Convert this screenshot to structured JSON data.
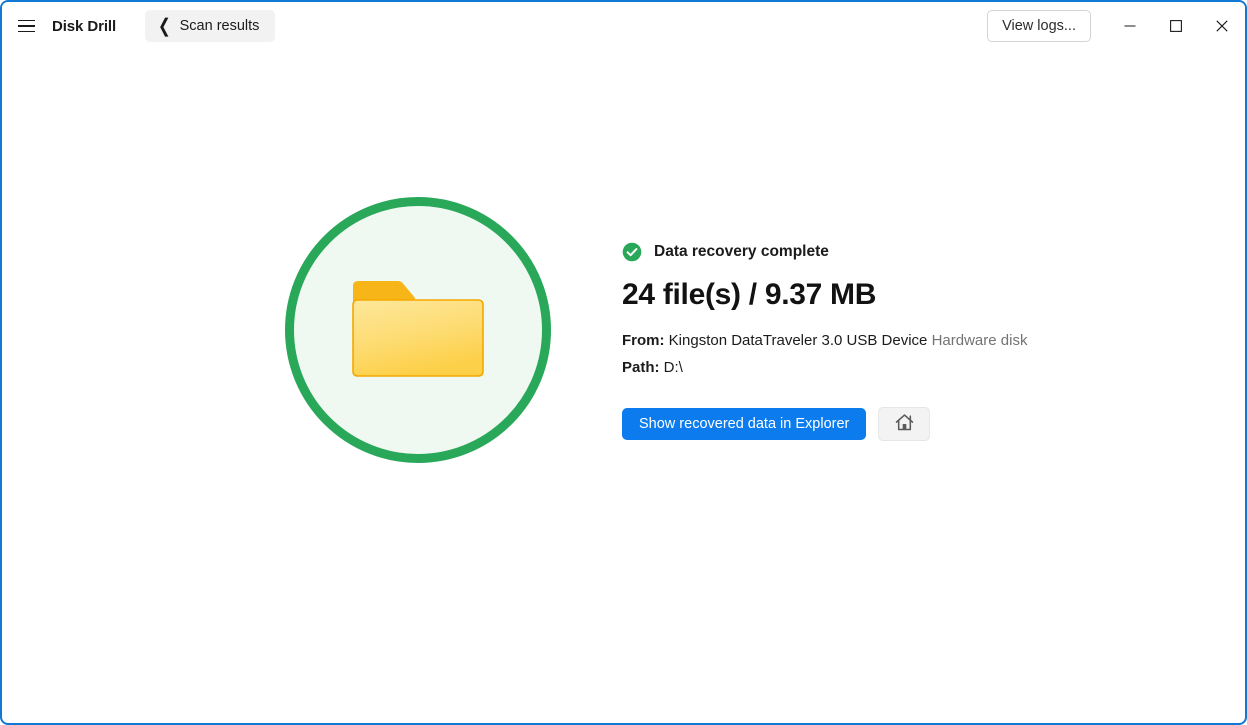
{
  "window": {
    "accent_border": "#1178d4",
    "background": "#ffffff"
  },
  "titlebar": {
    "menu_icon": "hamburger-menu-icon",
    "app_title": "Disk Drill",
    "back_button": {
      "icon": "chevron-left-icon",
      "label": "Scan results"
    },
    "view_logs_label": "View logs...",
    "window_controls": {
      "minimize": "minimize-icon",
      "maximize": "maximize-icon",
      "close": "close-icon"
    }
  },
  "hero": {
    "icon": "folder-icon",
    "ring_color": "#2aa85a",
    "fill_color": "#f0f8f2",
    "folder_back_color": "#f8b518",
    "folder_front_top_color": "#fde48e",
    "folder_front_bottom_color": "#fdd14a",
    "folder_border_color": "#f5a800"
  },
  "result": {
    "status_icon": "check-circle-icon",
    "status_color": "#2aa85a",
    "status_text": "Data recovery complete",
    "headline": "24 file(s) / 9.37 MB",
    "from_label": "From:",
    "from_value": "Kingston DataTraveler 3.0 USB Device",
    "from_note": "Hardware disk",
    "path_label": "Path:",
    "path_value": "D:\\",
    "primary_button_label": "Show recovered data in Explorer",
    "primary_button_color": "#0b7bed",
    "home_button_icon": "home-icon"
  }
}
